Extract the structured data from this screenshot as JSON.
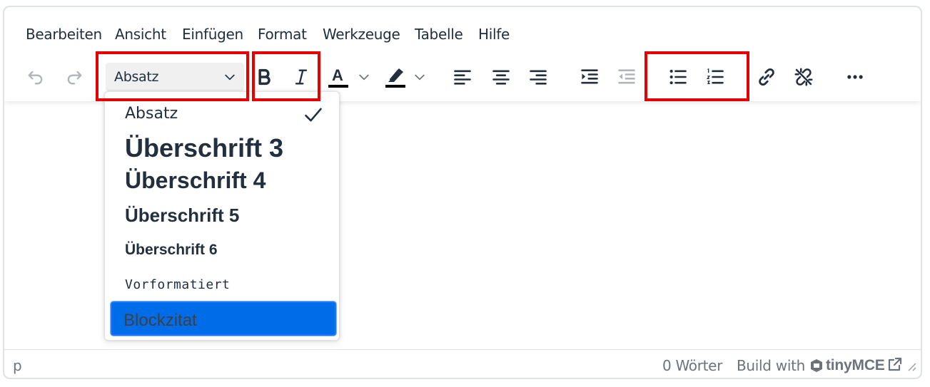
{
  "menubar": {
    "items": [
      "Bearbeiten",
      "Ansicht",
      "Einfügen",
      "Format",
      "Werkzeuge",
      "Tabelle",
      "Hilfe"
    ]
  },
  "toolbar": {
    "blocks_value": "Absatz",
    "text_color_letter": "A",
    "text_color": "#000000",
    "highlight_color": "#000000",
    "buttons": {
      "undo": "undo-icon",
      "redo": "redo-icon",
      "bold": "bold-icon",
      "italic": "italic-icon",
      "align_left": "align-left-icon",
      "align_center": "align-center-icon",
      "align_right": "align-right-icon",
      "indent": "indent-icon",
      "outdent": "outdent-icon",
      "bullet_list": "bullet-list-icon",
      "numbered_list": "numbered-list-icon",
      "link": "link-icon",
      "unlink": "unlink-icon",
      "more": "more-icon"
    }
  },
  "dropdown": {
    "items": [
      {
        "label": "Absatz",
        "selected": true
      },
      {
        "label": "Überschrift 3"
      },
      {
        "label": "Überschrift 4"
      },
      {
        "label": "Überschrift 5"
      },
      {
        "label": "Überschrift 6"
      },
      {
        "label": "Vorformatiert"
      },
      {
        "label": "Blockzitat",
        "highlighted": true
      }
    ]
  },
  "statusbar": {
    "path": "p",
    "word_count": "0 Wörter",
    "build_with": "Build with",
    "brand": "tinyMCE"
  },
  "colors": {
    "annotation_red": "#e60000",
    "active_item_blue": "#006ce7",
    "text": "#222f3e",
    "muted": "#6d737b"
  }
}
